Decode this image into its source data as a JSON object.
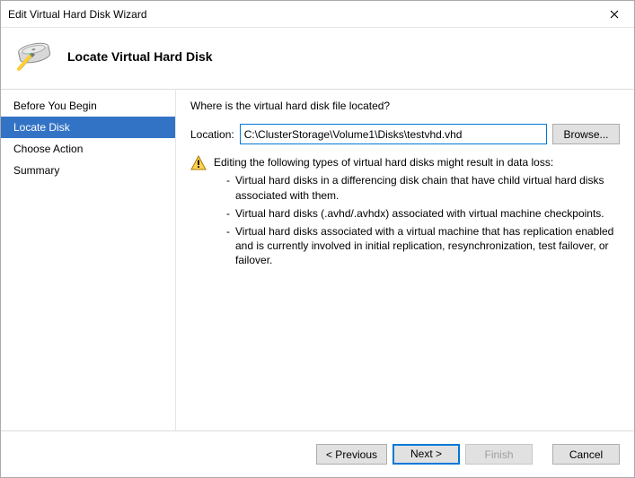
{
  "window": {
    "title": "Edit Virtual Hard Disk Wizard"
  },
  "header": {
    "title": "Locate Virtual Hard Disk"
  },
  "sidebar": {
    "steps": [
      {
        "label": "Before You Begin"
      },
      {
        "label": "Locate Disk"
      },
      {
        "label": "Choose Action"
      },
      {
        "label": "Summary"
      }
    ]
  },
  "content": {
    "question": "Where is the virtual hard disk file located?",
    "location_label": "Location:",
    "location_value": "C:\\ClusterStorage\\Volume1\\Disks\\testvhd.vhd",
    "browse_label": "Browse...",
    "warning_intro": "Editing the following types of virtual hard disks might result in data loss:",
    "warning_items": [
      "Virtual hard disks in a differencing disk chain that have child virtual hard disks associated with them.",
      "Virtual hard disks (.avhd/.avhdx) associated with virtual machine checkpoints.",
      "Virtual hard disks associated with a virtual machine that has replication enabled and is currently involved in initial replication, resynchronization, test failover, or failover."
    ]
  },
  "footer": {
    "previous": "< Previous",
    "next": "Next >",
    "finish": "Finish",
    "cancel": "Cancel"
  }
}
